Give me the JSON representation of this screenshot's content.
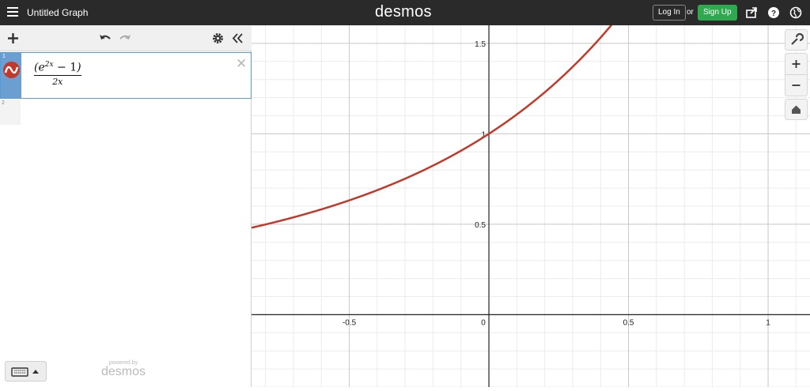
{
  "app": {
    "title": "Untitled Graph",
    "brand": "desmos",
    "login_label": "Log In",
    "or_label": "or",
    "signup_label": "Sign Up"
  },
  "expressions": [
    {
      "index": "1",
      "numerator": "e",
      "exponent": "2x",
      "numerator_rest": " − 1",
      "denominator": "2x",
      "color": "#c0392b"
    },
    {
      "index": "2"
    }
  ],
  "footer": {
    "powered_by": "powered by",
    "brand": "desmos"
  },
  "graph": {
    "x_range": [
      -0.85,
      1.15
    ],
    "y_range": [
      -0.4,
      1.6
    ],
    "x_ticks": [
      "-0.5",
      "0",
      "0.5",
      "1"
    ],
    "y_ticks": [
      "0.5",
      "1",
      "1.5"
    ],
    "curve_color": "#c0392b",
    "grid": true
  },
  "colors": {
    "topbar": "#2a2a2a",
    "signup": "#2fa84f",
    "selection": "#5b9bd5"
  }
}
